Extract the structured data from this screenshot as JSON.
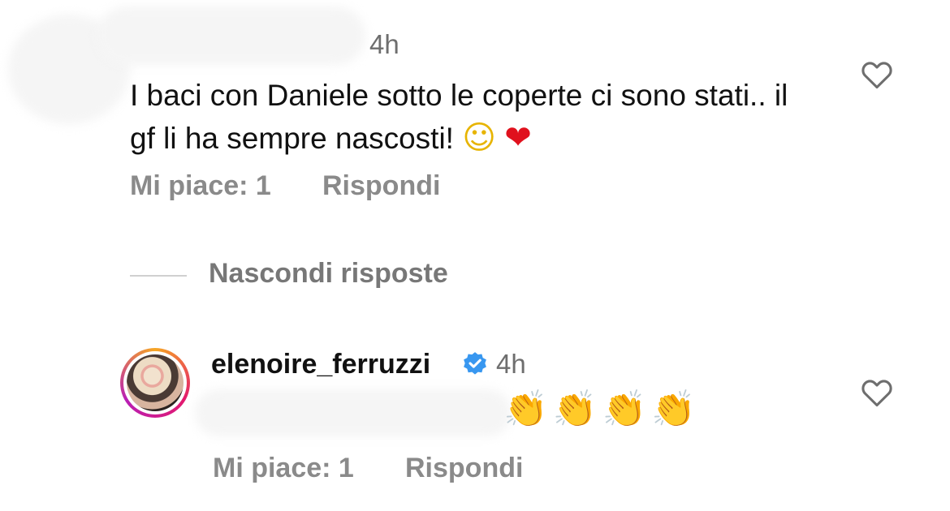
{
  "comment": {
    "time": "4h",
    "text": "I baci con Daniele sotto le coperte ci sono stati.. il gf li ha sempre nascosti!",
    "emojis": [
      "☺",
      "❤"
    ],
    "likes_label": "Mi piace: 1",
    "reply_label": "Rispondi",
    "heart_icon": "heart-outline-icon"
  },
  "hide_replies": {
    "label": "Nascondi risposte"
  },
  "reply": {
    "username": "elenoire_ferruzzi",
    "verified_icon": "verified-badge-icon",
    "verified_color": "#3897f0",
    "time": "4h",
    "emojis": "👏👏👏👏",
    "likes_label": "Mi piace: 1",
    "reply_label": "Rispondi",
    "heart_icon": "heart-outline-icon"
  },
  "colors": {
    "text": "#111111",
    "secondary": "#8a8a8a",
    "story_ring": [
      "#f6a623",
      "#e3196e",
      "#b81fb5"
    ]
  }
}
